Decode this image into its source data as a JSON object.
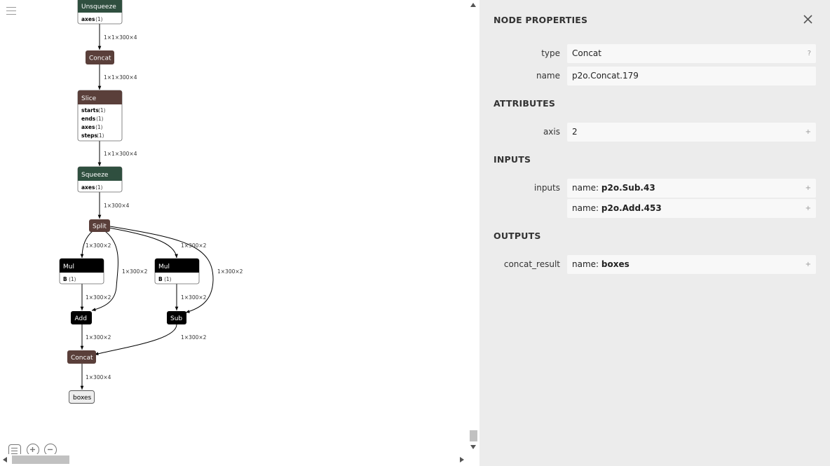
{
  "graph": {
    "menu_icon": "hamburger-menu-icon",
    "nodes": {
      "unsqueeze": {
        "title": "Unsqueeze",
        "color": "#2f4f3f",
        "attrs": [
          {
            "key": "axes",
            "val": "⟨1⟩"
          }
        ]
      },
      "concat_top": {
        "title": "Concat",
        "color": "#5a3f3a"
      },
      "slice": {
        "title": "Slice",
        "color": "#5a3f3a",
        "attrs": [
          {
            "key": "starts",
            "val": "⟨1⟩"
          },
          {
            "key": "ends",
            "val": "⟨1⟩"
          },
          {
            "key": "axes",
            "val": "⟨1⟩"
          },
          {
            "key": "steps",
            "val": "⟨1⟩"
          }
        ]
      },
      "squeeze": {
        "title": "Squeeze",
        "color": "#2f4f3f",
        "attrs": [
          {
            "key": "axes",
            "val": "⟨1⟩"
          }
        ]
      },
      "split": {
        "title": "Split",
        "color": "#5a3f3a"
      },
      "mul_left": {
        "title": "Mul",
        "color": "#000000",
        "attrs": [
          {
            "key": "B",
            "val": "⟨1⟩"
          }
        ]
      },
      "mul_right": {
        "title": "Mul",
        "color": "#000000",
        "attrs": [
          {
            "key": "B",
            "val": "⟨1⟩"
          }
        ]
      },
      "add": {
        "title": "Add",
        "color": "#000000"
      },
      "sub": {
        "title": "Sub",
        "color": "#000000"
      },
      "concat_bottom": {
        "title": "Concat",
        "color": "#5a3f3a"
      },
      "boxes": {
        "title": "boxes"
      }
    },
    "edges": {
      "unsqueeze_concat": "1×1×300×4",
      "concat_slice": "1×1×300×4",
      "slice_squeeze": "1×1×300×4",
      "squeeze_split": "1×300×4",
      "split_mulL": "1×300×2",
      "split_add": "1×300×2",
      "split_mulR": "1×300×2",
      "split_sub": "1×300×2",
      "mulL_add": "1×300×2",
      "mulR_sub": "1×300×2",
      "add_concat": "1×300×2",
      "sub_concat": "1×300×2",
      "concat_boxes": "1×300×4"
    }
  },
  "toolbar": {
    "list_icon": "list-view-icon",
    "zoom_in_icon": "zoom-in-icon",
    "zoom_out_icon": "zoom-out-icon"
  },
  "panel": {
    "title": "NODE PROPERTIES",
    "close_icon": "close-icon",
    "properties": {
      "type_label": "type",
      "type_value": "Concat",
      "type_suffix": "?",
      "name_label": "name",
      "name_value": "p2o.Concat.179"
    },
    "attributes": {
      "title": "ATTRIBUTES",
      "axis_label": "axis",
      "axis_value": "2",
      "axis_suffix": "+"
    },
    "inputs": {
      "title": "INPUTS",
      "label": "inputs",
      "name_prefix": "name: ",
      "items": [
        "p2o.Sub.43",
        "p2o.Add.453"
      ],
      "suffix": "+"
    },
    "outputs": {
      "title": "OUTPUTS",
      "label": "concat_result",
      "name_prefix": "name: ",
      "value": "boxes",
      "suffix": "+"
    }
  }
}
